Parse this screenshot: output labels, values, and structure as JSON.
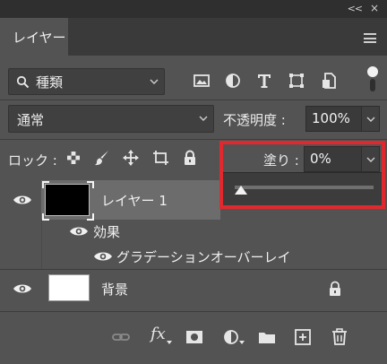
{
  "window": {
    "collapse_glyph": "<<",
    "close_glyph": "×"
  },
  "panel": {
    "tab_label": "レイヤー",
    "menu_icon": "hamburger-menu-icon"
  },
  "filter": {
    "kind_label": "種類",
    "icons": [
      "image-filter-icon",
      "adjustment-filter-icon",
      "type-filter-icon",
      "shape-filter-icon",
      "smart-object-filter-icon"
    ],
    "toggle": "filter-toggle"
  },
  "blend": {
    "mode": "通常",
    "opacity_label": "不透明度 :",
    "opacity_value": "100%"
  },
  "lock": {
    "label": "ロック :",
    "icons": [
      "lock-transparent-pixels-icon",
      "lock-image-pixels-icon",
      "lock-position-icon",
      "lock-artboard-icon",
      "lock-all-icon"
    ]
  },
  "fill": {
    "label": "塗り :",
    "value": "0%",
    "slider_fraction": 0
  },
  "layers": [
    {
      "name": "レイヤー 1",
      "selected": true
    },
    {
      "name": "効果",
      "type": "effects-group"
    },
    {
      "name": "グラデーションオーバーレイ",
      "type": "effect"
    },
    {
      "name": "背景",
      "locked": true
    }
  ],
  "bottom_toolbar": {
    "fx_label": "fx",
    "icons": [
      "link-layers-icon",
      "fx-icon",
      "layer-mask-icon",
      "adjustment-layer-icon",
      "group-folder-icon",
      "new-layer-icon",
      "trash-icon"
    ]
  },
  "colors": {
    "panel_bg": "#535353",
    "highlight_border": "#e0292e",
    "selected_row": "#6c6c6c"
  }
}
